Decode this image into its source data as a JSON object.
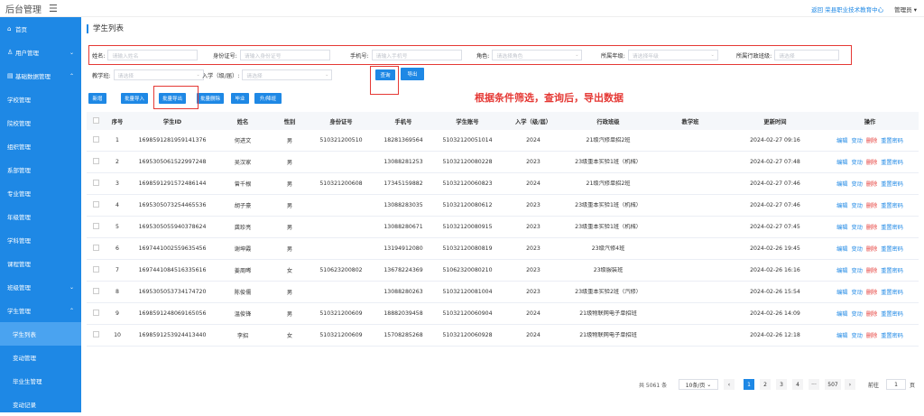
{
  "topbar": {
    "brand": "后台管理",
    "home_link": "返回 荣县职业技术教育中心",
    "user": "管理员"
  },
  "sidebar": {
    "items": [
      {
        "label": "首页",
        "icon": "⌂",
        "arrow": ""
      },
      {
        "label": "用户管理",
        "icon": "♙",
        "arrow": "⌄"
      },
      {
        "label": "基础数据管理",
        "icon": "▤",
        "arrow": "⌃"
      },
      {
        "label": "学校管理",
        "icon": "",
        "arrow": ""
      },
      {
        "label": "院校管理",
        "icon": "",
        "arrow": ""
      },
      {
        "label": "组织管理",
        "icon": "",
        "arrow": ""
      },
      {
        "label": "系部管理",
        "icon": "",
        "arrow": ""
      },
      {
        "label": "专业管理",
        "icon": "",
        "arrow": ""
      },
      {
        "label": "年级管理",
        "icon": "",
        "arrow": ""
      },
      {
        "label": "学科管理",
        "icon": "",
        "arrow": ""
      },
      {
        "label": "课程管理",
        "icon": "",
        "arrow": ""
      },
      {
        "label": "班级管理",
        "icon": "",
        "arrow": "⌄"
      },
      {
        "label": "学生管理",
        "icon": "",
        "arrow": "⌃"
      },
      {
        "label": "学生列表",
        "icon": "",
        "arrow": ""
      },
      {
        "label": "变动管理",
        "icon": "",
        "arrow": ""
      },
      {
        "label": "毕业生管理",
        "icon": "",
        "arrow": ""
      },
      {
        "label": "变动记录",
        "icon": "",
        "arrow": ""
      }
    ]
  },
  "page_title": "学生列表",
  "filters": {
    "name": {
      "label": "姓名:",
      "placeholder": "请输入姓名"
    },
    "idcard": {
      "label": "身份证号:",
      "placeholder": "请输入身份证号"
    },
    "phone": {
      "label": "手机号:",
      "placeholder": "请输入手机号"
    },
    "role": {
      "label": "角色:",
      "placeholder": "请选择角色"
    },
    "grade": {
      "label": "所属年级:",
      "placeholder": "请选择年级"
    },
    "admin_class": {
      "label": "所属行政班级:",
      "placeholder": "请选择"
    },
    "teach_class": {
      "label": "教学班:",
      "placeholder": "请选择"
    },
    "enroll": {
      "label": "入学（级/届）:",
      "placeholder": "请选择"
    },
    "query": "查询",
    "export": "导出"
  },
  "toolbar": {
    "add": "新增",
    "batch_import": "批量导入",
    "batch_export": "批量导出",
    "batch_delete": "批量删除",
    "graduate": "毕业",
    "upgrade": "升/降班"
  },
  "annotation": "根据条件筛选，查询后，导出数据",
  "table": {
    "headers": [
      "",
      "序号",
      "学生ID",
      "姓名",
      "性别",
      "身份证号",
      "手机号",
      "学生账号",
      "入学（级/届）",
      "行政班级",
      "教学班",
      "更新时间",
      "操作"
    ],
    "ops": [
      "编辑",
      "变动",
      "删除",
      "重置密码"
    ],
    "rows": [
      [
        "1",
        "1698591281959141376",
        "何进文",
        "男",
        "510321200510",
        "18281369564",
        "51032120051014",
        "2024",
        "21级汽修单招2班",
        "",
        "2024-02-27 09:16"
      ],
      [
        "2",
        "1695305061522997248",
        "吴汉家",
        "男",
        "",
        "13088281253",
        "51032120080228",
        "2023",
        "23级重本实验1班（机械）",
        "",
        "2024-02-27 07:48"
      ],
      [
        "3",
        "1698591291572486144",
        "曾千根",
        "男",
        "510321200608",
        "17345159882",
        "51032120060823",
        "2024",
        "21级汽修单招2班",
        "",
        "2024-02-27 07:46"
      ],
      [
        "4",
        "1695305073254465536",
        "胡子豪",
        "男",
        "",
        "13088283035",
        "51032120080612",
        "2023",
        "23级重本实验1班（机械）",
        "",
        "2024-02-27 07:46"
      ],
      [
        "5",
        "1695305055940378624",
        "龚珍亮",
        "男",
        "",
        "13088280671",
        "51032120080915",
        "2023",
        "23级重本实验1班（机械）",
        "",
        "2024-02-27 07:45"
      ],
      [
        "6",
        "1697441002559635456",
        "谢坤霞",
        "男",
        "",
        "13194912080",
        "51032120080819",
        "2023",
        "23级汽修4班",
        "",
        "2024-02-26 19:45"
      ],
      [
        "7",
        "1697441084516335616",
        "姜周晞",
        "女",
        "510623200802",
        "13678224369",
        "51062320080210",
        "2023",
        "23级服装班",
        "",
        "2024-02-26 16:16"
      ],
      [
        "8",
        "1695305053734174720",
        "陈俊儒",
        "男",
        "",
        "13088280263",
        "51032120081004",
        "2023",
        "23级重本实验2班（汽修）",
        "",
        "2024-02-26 15:54"
      ],
      [
        "9",
        "1698591248069165056",
        "温俊锋",
        "男",
        "510321200609",
        "18882039458",
        "51032120060904",
        "2024",
        "21级物联网电子单招班",
        "",
        "2024-02-26 14:09"
      ],
      [
        "10",
        "1698591253924413440",
        "李招",
        "女",
        "510321200609",
        "15708285268",
        "51032120060928",
        "2024",
        "21级物联网电子单招班",
        "",
        "2024-02-26 12:18"
      ]
    ]
  },
  "pager": {
    "total": "共 5061 条",
    "size": "10条/页",
    "pages": [
      "1",
      "2",
      "3",
      "4",
      "···",
      "507"
    ],
    "prev": "‹",
    "next": "›",
    "goto": "前往",
    "goto_value": "1",
    "page_unit": "页"
  }
}
